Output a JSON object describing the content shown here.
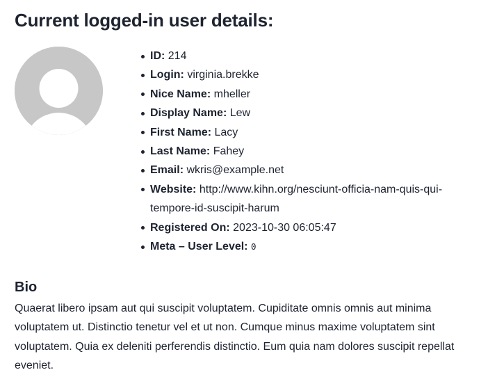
{
  "page": {
    "title": "Current logged-in user details:"
  },
  "avatar": {
    "icon": "default-user-avatar-icon",
    "bg_color": "#c7c7c7",
    "fg_color": "#ffffff"
  },
  "details": [
    {
      "label": "ID:",
      "value": "214"
    },
    {
      "label": "Login:",
      "value": "virginia.brekke"
    },
    {
      "label": "Nice Name:",
      "value": "mheller"
    },
    {
      "label": "Display Name:",
      "value": "Lew"
    },
    {
      "label": "First Name:",
      "value": "Lacy"
    },
    {
      "label": "Last Name:",
      "value": "Fahey"
    },
    {
      "label": "Email:",
      "value": "wkris@example.net"
    },
    {
      "label": "Website:",
      "value": "http://www.kihn.org/nesciunt-officia-nam-quis-qui-tempore-id-suscipit-harum"
    },
    {
      "label": "Registered On:",
      "value": "2023-10-30 06:05:47"
    },
    {
      "label": "Meta – User Level:",
      "value": "0"
    }
  ],
  "bio": {
    "heading": "Bio",
    "text": "Quaerat libero ipsam aut qui suscipit voluptatem. Cupiditate omnis omnis aut minima voluptatem ut. Distinctio tenetur vel et ut non. Cumque minus maxime voluptatem sint voluptatem. Quia ex deleniti perferendis distinctio. Eum quia nam dolores suscipit repellat eveniet."
  },
  "colors": {
    "text": "#1e2330",
    "background": "#ffffff"
  }
}
